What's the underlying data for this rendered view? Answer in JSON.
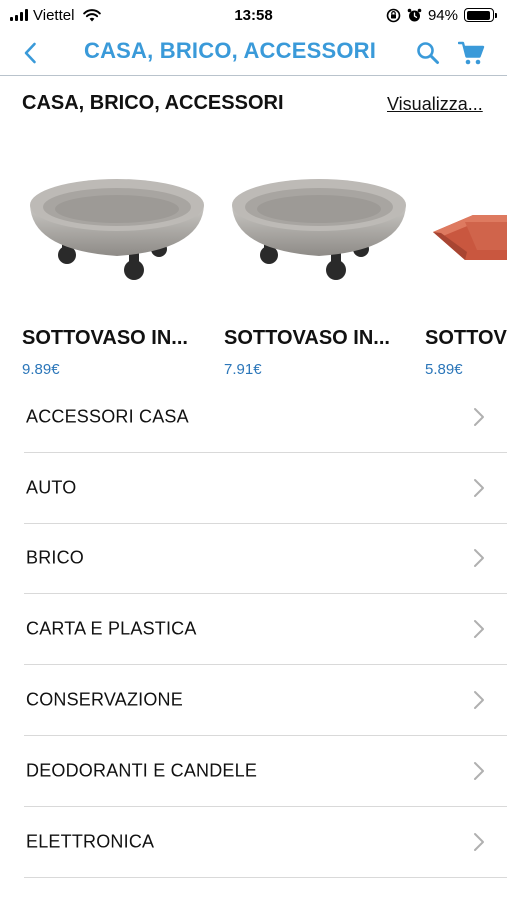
{
  "status_bar": {
    "carrier": "Viettel",
    "time": "13:58",
    "battery_percent": "94%",
    "battery_level": 0.94,
    "icons": [
      "signal-icon",
      "wifi-icon",
      "rotation-lock-icon",
      "alarm-icon",
      "battery-icon"
    ]
  },
  "nav": {
    "title": "CASA, BRICO, ACCESSORI",
    "back_icon": "chevron-left-icon",
    "search_icon": "search-icon",
    "cart_icon": "cart-icon",
    "accent_color": "#3a9ad9"
  },
  "section": {
    "title": "CASA, BRICO, ACCESSORI",
    "link": "Visualizza..."
  },
  "products": [
    {
      "name": "SOTTOVASO IN...",
      "price": "9.89€",
      "image": "grey-plant-saucer-on-wheels"
    },
    {
      "name": "SOTTOVASO IN...",
      "price": "7.91€",
      "image": "grey-plant-saucer-on-wheels"
    },
    {
      "name": "SOTTOV",
      "price": "5.89€",
      "image": "terracotta-square-saucer"
    }
  ],
  "categories": [
    {
      "label": "ACCESSORI CASA"
    },
    {
      "label": "AUTO"
    },
    {
      "label": "BRICO"
    },
    {
      "label": "CARTA E PLASTICA"
    },
    {
      "label": "CONSERVAZIONE"
    },
    {
      "label": "DEODORANTI E CANDELE"
    },
    {
      "label": "ELETTRONICA"
    }
  ],
  "colors": {
    "price": "#2b76b9",
    "divider": "#d9d9d9",
    "chevron": "#b0b0b0"
  }
}
